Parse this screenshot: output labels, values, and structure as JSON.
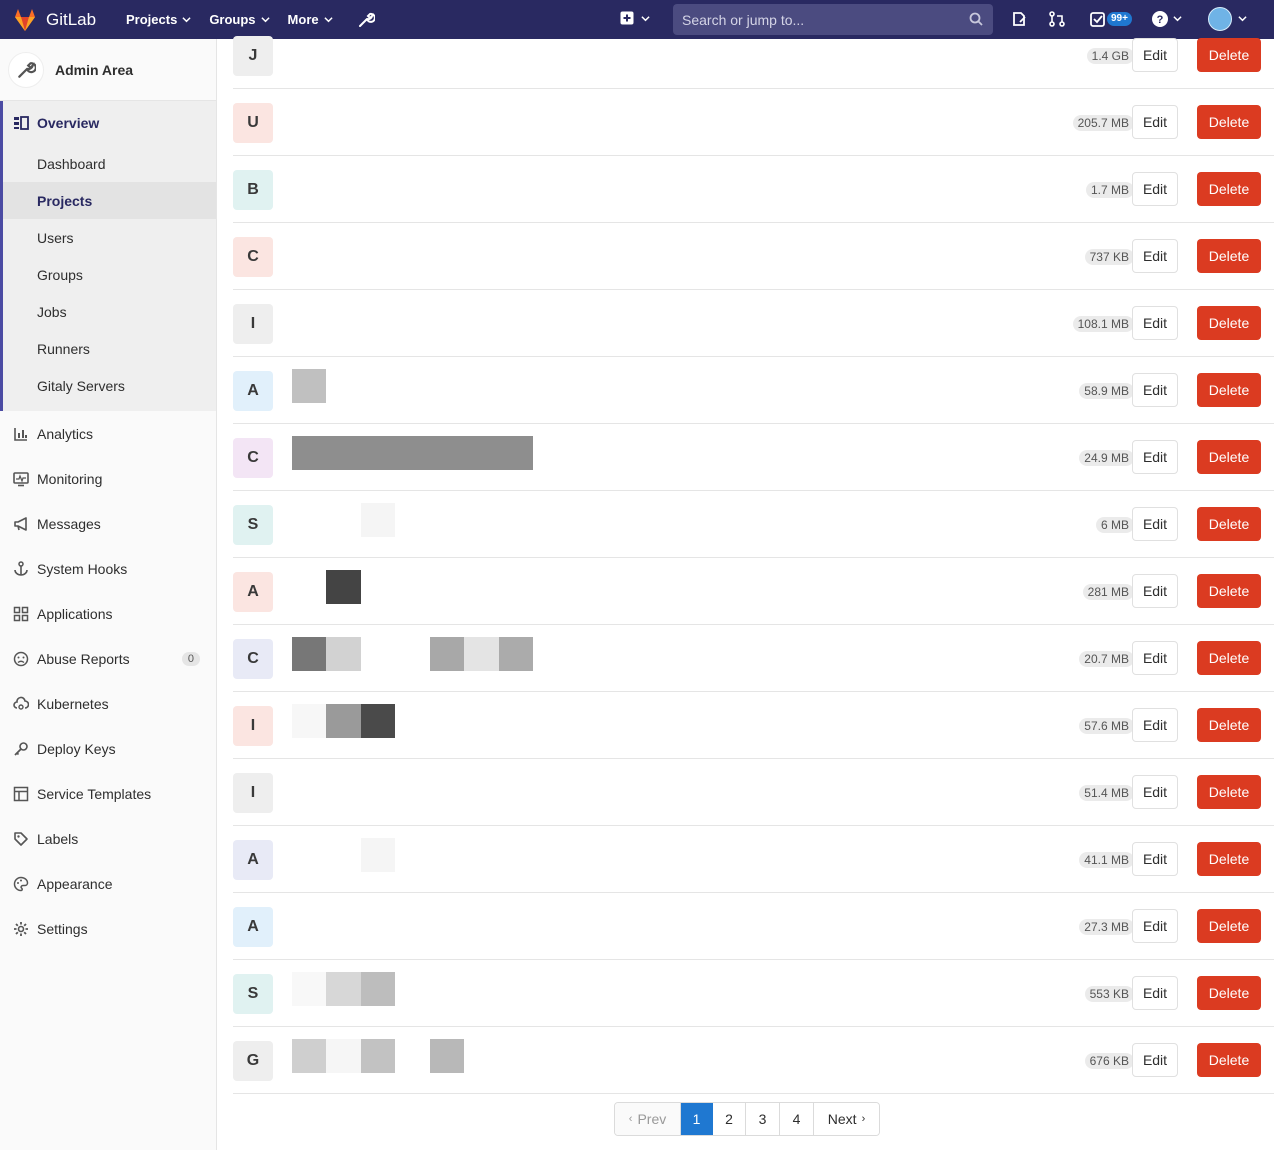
{
  "topbar": {
    "brand": "GitLab",
    "nav": [
      "Projects",
      "Groups",
      "More"
    ],
    "search_placeholder": "Search or jump to...",
    "todo_badge": "99+"
  },
  "sidebar": {
    "header": "Admin Area",
    "overview": {
      "label": "Overview",
      "items": [
        {
          "label": "Dashboard",
          "active": false
        },
        {
          "label": "Projects",
          "active": true
        },
        {
          "label": "Users",
          "active": false
        },
        {
          "label": "Groups",
          "active": false
        },
        {
          "label": "Jobs",
          "active": false
        },
        {
          "label": "Runners",
          "active": false
        },
        {
          "label": "Gitaly Servers",
          "active": false
        }
      ]
    },
    "items": [
      {
        "label": "Analytics",
        "icon": "chart-icon"
      },
      {
        "label": "Monitoring",
        "icon": "monitor-icon"
      },
      {
        "label": "Messages",
        "icon": "megaphone-icon"
      },
      {
        "label": "System Hooks",
        "icon": "anchor-icon"
      },
      {
        "label": "Applications",
        "icon": "applications-icon"
      },
      {
        "label": "Abuse Reports",
        "icon": "abuse-icon",
        "count": "0"
      },
      {
        "label": "Kubernetes",
        "icon": "cloud-gear-icon"
      },
      {
        "label": "Deploy Keys",
        "icon": "key-icon"
      },
      {
        "label": "Service Templates",
        "icon": "template-icon"
      },
      {
        "label": "Labels",
        "icon": "label-icon"
      },
      {
        "label": "Appearance",
        "icon": "palette-icon"
      },
      {
        "label": "Settings",
        "icon": "settings-icon"
      }
    ]
  },
  "projects": [
    {
      "letter": "J",
      "size": "1.4 GB",
      "bg": "#eeeeee"
    },
    {
      "letter": "U",
      "size": "205.7 MB",
      "bg": "#fbe5e1"
    },
    {
      "letter": "B",
      "size": "1.7 MB",
      "bg": "#e0f2f1"
    },
    {
      "letter": "C",
      "size": "737 KB",
      "bg": "#fbe5e1"
    },
    {
      "letter": "I",
      "size": "108.1 MB",
      "bg": "#eeeeee"
    },
    {
      "letter": "A",
      "size": "58.9 MB",
      "bg": "#e1f0fb"
    },
    {
      "letter": "C",
      "size": "24.9 MB",
      "bg": "#f3e5f5"
    },
    {
      "letter": "S",
      "size": "6 MB",
      "bg": "#e0f2f1"
    },
    {
      "letter": "A",
      "size": "281 MB",
      "bg": "#fbe5e1"
    },
    {
      "letter": "C",
      "size": "20.7 MB",
      "bg": "#e8eaf6"
    },
    {
      "letter": "I",
      "size": "57.6 MB",
      "bg": "#fbe5e1"
    },
    {
      "letter": "I",
      "size": "51.4 MB",
      "bg": "#eeeeee"
    },
    {
      "letter": "A",
      "size": "41.1 MB",
      "bg": "#e8eaf6"
    },
    {
      "letter": "A",
      "size": "27.3 MB",
      "bg": "#e1f0fb"
    },
    {
      "letter": "S",
      "size": "553 KB",
      "bg": "#e0f2f1"
    },
    {
      "letter": "G",
      "size": "676 KB",
      "bg": "#eeeeee"
    }
  ],
  "buttons": {
    "edit": "Edit",
    "delete": "Delete"
  },
  "pagination": {
    "prev": "Prev",
    "pages": [
      "1",
      "2",
      "3",
      "4"
    ],
    "current": "1",
    "next": "Next"
  }
}
